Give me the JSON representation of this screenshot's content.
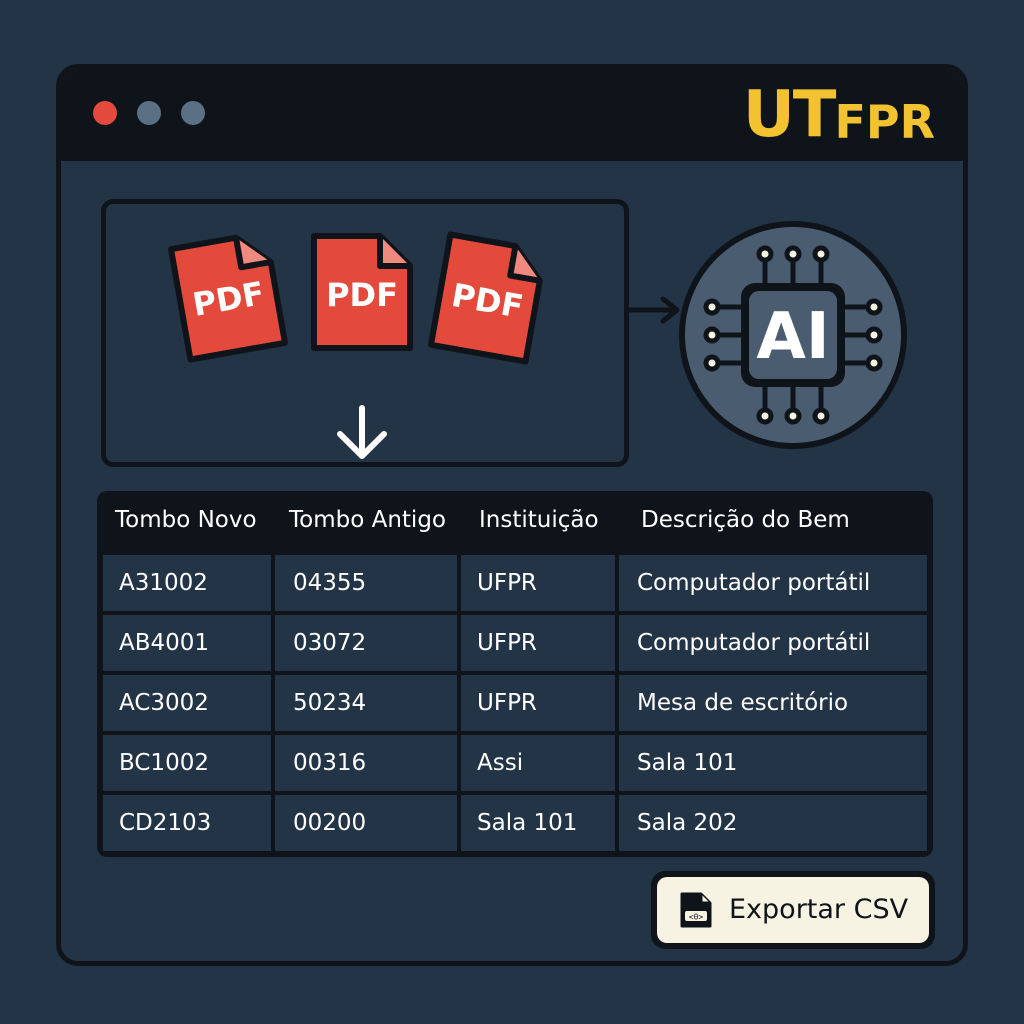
{
  "window": {
    "brand": "UTFPR"
  },
  "upload": {
    "files": [
      {
        "label": "PDF"
      },
      {
        "label": "PDF"
      },
      {
        "label": "PDF"
      }
    ]
  },
  "processor": {
    "label": "AI"
  },
  "table": {
    "headers": [
      "Tombo Novo",
      "Tombo Antigo",
      "Instituição",
      "Descrição do Bem"
    ],
    "rows": [
      [
        "A31002",
        "04355",
        "UFPR",
        "Computador portátil"
      ],
      [
        "AB4001",
        "03072",
        "UFPR",
        "Computador portátil"
      ],
      [
        "AC3002",
        "50234",
        "UFPR",
        "Mesa de escritório"
      ],
      [
        "BC1002",
        "00316",
        "Assi",
        "Sala 101"
      ],
      [
        "CD2103",
        "00200",
        "Sala 101",
        "Sala 202"
      ]
    ]
  },
  "export": {
    "label": "Exportar CSV",
    "icon": "csv-file-icon"
  },
  "colors": {
    "background": "#243447",
    "frame": "#0f141a",
    "brand": "#f2c230",
    "pdf": "#e34a3b",
    "button": "#f7f3e3"
  }
}
